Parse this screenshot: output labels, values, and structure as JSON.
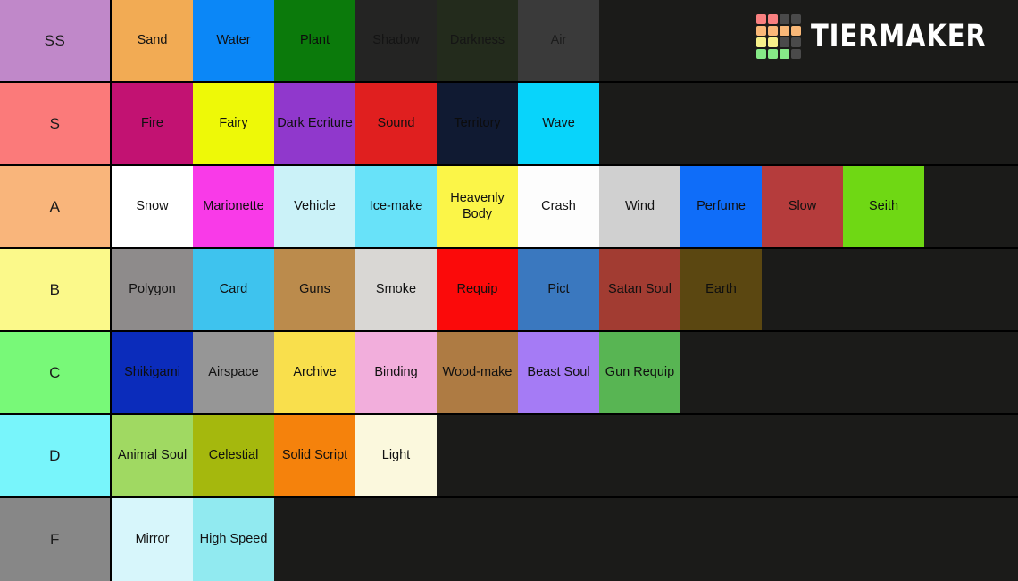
{
  "brand": {
    "name": "TIERMAKER",
    "logo_colors": {
      "red": "#f98080",
      "orange": "#f9b878",
      "yellow": "#f6f08a",
      "green": "#86e987",
      "empty": "#4a4a4a"
    },
    "logo_grid": [
      [
        "red",
        "red",
        "empty",
        "empty"
      ],
      [
        "orange",
        "orange",
        "orange",
        "orange"
      ],
      [
        "yellow",
        "yellow",
        "empty",
        "empty"
      ],
      [
        "green",
        "green",
        "green",
        "empty"
      ]
    ]
  },
  "background_color": "#1b1b19",
  "rows": [
    {
      "label": "SS",
      "label_color": "#c088c9",
      "items": [
        {
          "text": "Sand",
          "color": "#f2ab54",
          "text_color": "#121212"
        },
        {
          "text": "Water",
          "color": "#0b87f7",
          "text_color": "#101010"
        },
        {
          "text": "Plant",
          "color": "#0b7a0b",
          "text_color": "#0c0c0c"
        },
        {
          "text": "Shadow",
          "color": "#242423",
          "text_color": "#141414"
        },
        {
          "text": "Darkness",
          "color": "#232b1c",
          "text_color": "#151515"
        },
        {
          "text": "Air",
          "color": "#3a3a3a",
          "text_color": "#1c1c1c"
        }
      ]
    },
    {
      "label": "S",
      "label_color": "#fb7a7a",
      "items": [
        {
          "text": "Fire",
          "color": "#c21272",
          "text_color": "#101010"
        },
        {
          "text": "Fairy",
          "color": "#eef907",
          "text_color": "#111111"
        },
        {
          "text": "Dark Ecriture",
          "color": "#9038cc",
          "text_color": "#101010"
        },
        {
          "text": "Sound",
          "color": "#e01f1f",
          "text_color": "#101010"
        },
        {
          "text": "Territory",
          "color": "#101a32",
          "text_color": "#0c0c0c"
        },
        {
          "text": "Wave",
          "color": "#08d4fb",
          "text_color": "#101010"
        }
      ]
    },
    {
      "label": "A",
      "label_color": "#f9b57b",
      "items": [
        {
          "text": "Snow",
          "color": "#ffffff",
          "text_color": "#111111"
        },
        {
          "text": "Marionette",
          "color": "#f93ae8",
          "text_color": "#101010"
        },
        {
          "text": "Vehicle",
          "color": "#cbf2f8",
          "text_color": "#111111"
        },
        {
          "text": "Ice-make",
          "color": "#68e2f9",
          "text_color": "#111111"
        },
        {
          "text": "Heavenly Body",
          "color": "#fbf548",
          "text_color": "#111111"
        },
        {
          "text": "Crash",
          "color": "#fdfdfd",
          "text_color": "#111111"
        },
        {
          "text": "Wind",
          "color": "#d0d0d0",
          "text_color": "#111111"
        },
        {
          "text": "Perfume",
          "color": "#0f6df9",
          "text_color": "#101010"
        },
        {
          "text": "Slow",
          "color": "#b53c3c",
          "text_color": "#101010"
        },
        {
          "text": "Seith",
          "color": "#6fd814",
          "text_color": "#101010"
        }
      ]
    },
    {
      "label": "B",
      "label_color": "#fbf98a",
      "items": [
        {
          "text": "Polygon",
          "color": "#8e8b8b",
          "text_color": "#111111"
        },
        {
          "text": "Card",
          "color": "#3ec3ee",
          "text_color": "#111111"
        },
        {
          "text": "Guns",
          "color": "#bb8b4c",
          "text_color": "#111111"
        },
        {
          "text": "Smoke",
          "color": "#d9d7d4",
          "text_color": "#111111"
        },
        {
          "text": "Requip",
          "color": "#fb0a0a",
          "text_color": "#101010"
        },
        {
          "text": "Pict",
          "color": "#3a78bf",
          "text_color": "#101010"
        },
        {
          "text": "Satan Soul",
          "color": "#a23c32",
          "text_color": "#101010"
        },
        {
          "text": "Earth",
          "color": "#5b4711",
          "text_color": "#0f0f0f"
        }
      ]
    },
    {
      "label": "C",
      "label_color": "#78f978",
      "items": [
        {
          "text": "Shikigami",
          "color": "#0b2cbb",
          "text_color": "#0e0e0e"
        },
        {
          "text": "Airspace",
          "color": "#969696",
          "text_color": "#111111"
        },
        {
          "text": "Archive",
          "color": "#f9df4c",
          "text_color": "#111111"
        },
        {
          "text": "Binding",
          "color": "#f2aedc",
          "text_color": "#111111"
        },
        {
          "text": "Wood-make",
          "color": "#ae7b43",
          "text_color": "#111111"
        },
        {
          "text": "Beast Soul",
          "color": "#a57bf5",
          "text_color": "#101010"
        },
        {
          "text": "Gun Requip",
          "color": "#58b553",
          "text_color": "#101010"
        }
      ]
    },
    {
      "label": "D",
      "label_color": "#78f5fb",
      "items": [
        {
          "text": "Animal Soul",
          "color": "#a0d962",
          "text_color": "#111111"
        },
        {
          "text": "Celestial",
          "color": "#a5b80d",
          "text_color": "#101010"
        },
        {
          "text": "Solid Script",
          "color": "#f5820c",
          "text_color": "#111111"
        },
        {
          "text": "Light",
          "color": "#fbf8dd",
          "text_color": "#111111"
        }
      ]
    },
    {
      "label": "F",
      "label_color": "#878787",
      "items": [
        {
          "text": "Mirror",
          "color": "#d7f6fb",
          "text_color": "#111111"
        },
        {
          "text": "High Speed",
          "color": "#91eaf0",
          "text_color": "#111111"
        }
      ]
    }
  ]
}
